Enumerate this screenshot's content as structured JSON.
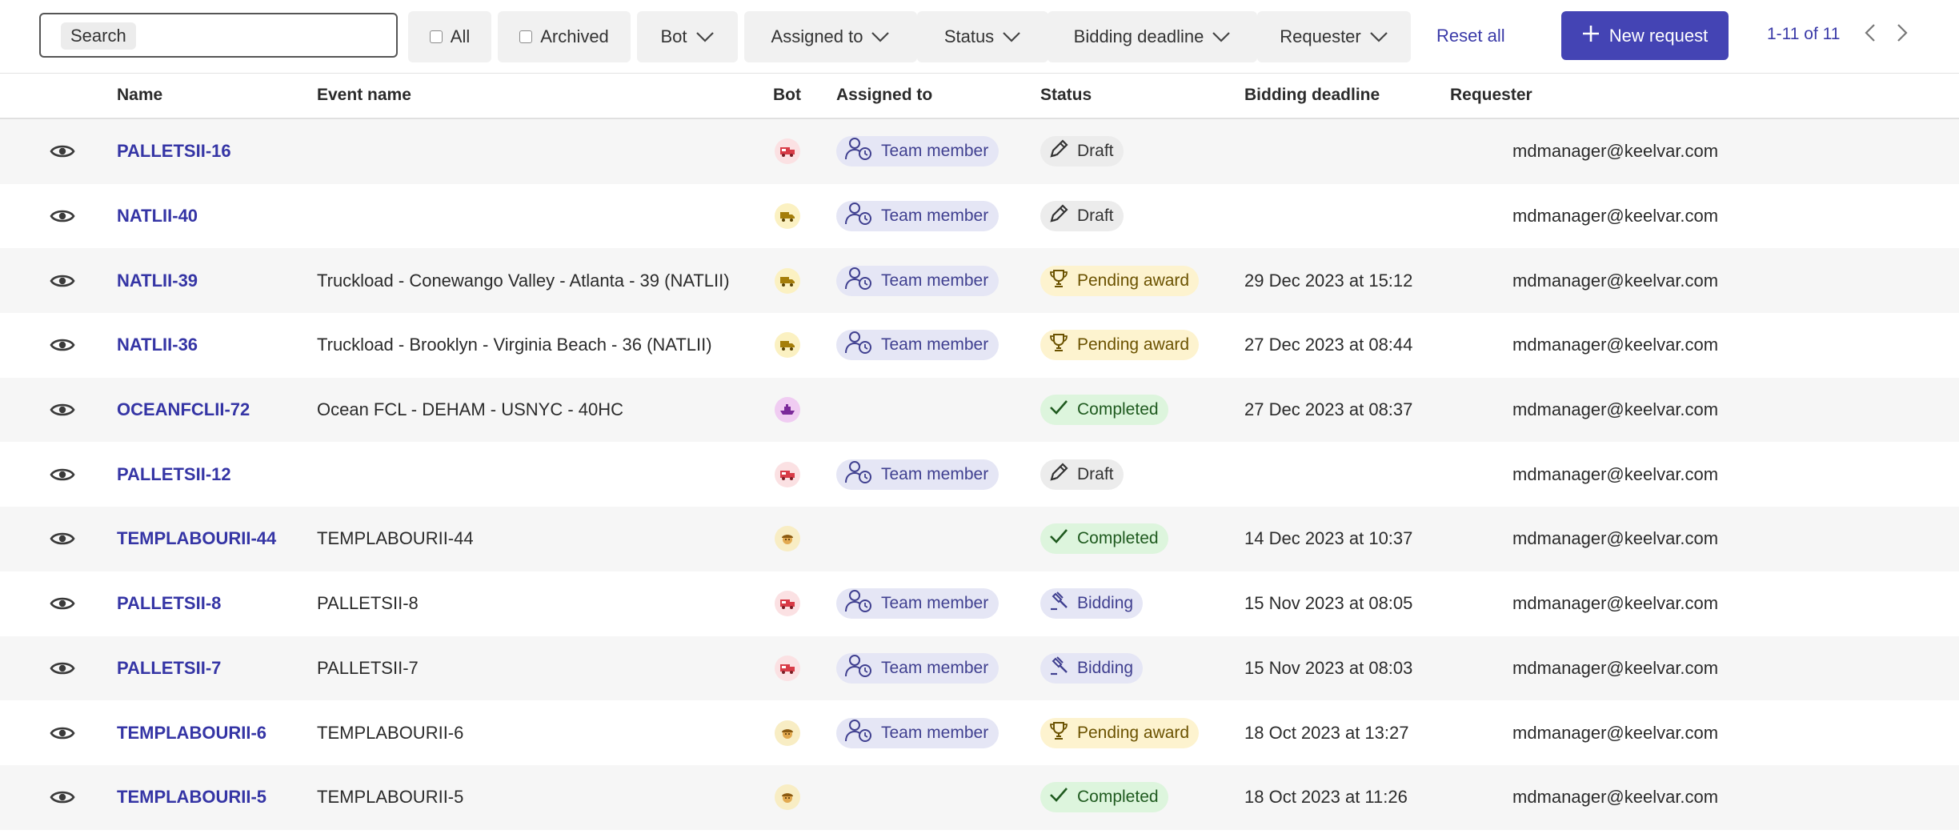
{
  "toolbar": {
    "search_label": "Search",
    "filters": {
      "all": "All",
      "archived": "Archived",
      "bot": "Bot",
      "assigned_to": "Assigned to",
      "status": "Status",
      "bidding_deadline": "Bidding deadline",
      "requester": "Requester"
    },
    "reset_all": "Reset all",
    "new_request": "New request",
    "pagination": "1-11 of 11"
  },
  "columns": {
    "name": "Name",
    "event_name": "Event name",
    "bot": "Bot",
    "assigned_to": "Assigned to",
    "status": "Status",
    "bidding_deadline": "Bidding deadline",
    "requester": "Requester"
  },
  "colors": {
    "accent": "#4444b4",
    "link": "#3535a5",
    "draft": "#ececec",
    "pending": "#fdf3cf",
    "completed": "#ddf5dd",
    "bidding": "#e5e6f5"
  },
  "rows": [
    {
      "name": "PALLETSII-16",
      "event": "",
      "bot": "pallet-bot-icon",
      "assigned": "Team member",
      "status": "Draft",
      "status_type": "draft",
      "deadline": "",
      "requester": "mdmanager@keelvar.com"
    },
    {
      "name": "NATLII-40",
      "event": "",
      "bot": "truck-bot-icon",
      "assigned": "Team member",
      "status": "Draft",
      "status_type": "draft",
      "deadline": "",
      "requester": "mdmanager@keelvar.com"
    },
    {
      "name": "NATLII-39",
      "event": "Truckload - Conewango Valley - Atlanta - 39 (NATLII)",
      "bot": "truck-bot-icon",
      "assigned": "Team member",
      "status": "Pending award",
      "status_type": "pending",
      "deadline": "29 Dec 2023 at 15:12",
      "requester": "mdmanager@keelvar.com"
    },
    {
      "name": "NATLII-36",
      "event": "Truckload - Brooklyn - Virginia Beach - 36 (NATLII)",
      "bot": "truck-bot-icon",
      "assigned": "Team member",
      "status": "Pending award",
      "status_type": "pending",
      "deadline": "27 Dec 2023 at 08:44",
      "requester": "mdmanager@keelvar.com"
    },
    {
      "name": "OCEANFCLII-72",
      "event": "Ocean FCL - DEHAM - USNYC - 40HC",
      "bot": "ship-bot-icon",
      "assigned": "",
      "status": "Completed",
      "status_type": "completed",
      "deadline": "27 Dec 2023 at 08:37",
      "requester": "mdmanager@keelvar.com"
    },
    {
      "name": "PALLETSII-12",
      "event": "",
      "bot": "pallet-bot-icon",
      "assigned": "Team member",
      "status": "Draft",
      "status_type": "draft",
      "deadline": "",
      "requester": "mdmanager@keelvar.com"
    },
    {
      "name": "TEMPLABOURII-44",
      "event": "TEMPLABOURII-44",
      "bot": "worker-bot-icon",
      "assigned": "",
      "status": "Completed",
      "status_type": "completed",
      "deadline": "14 Dec 2023 at 10:37",
      "requester": "mdmanager@keelvar.com"
    },
    {
      "name": "PALLETSII-8",
      "event": "PALLETSII-8",
      "bot": "pallet-bot-icon",
      "assigned": "Team member",
      "status": "Bidding",
      "status_type": "bidding",
      "deadline": "15 Nov 2023 at 08:05",
      "requester": "mdmanager@keelvar.com"
    },
    {
      "name": "PALLETSII-7",
      "event": "PALLETSII-7",
      "bot": "pallet-bot-icon",
      "assigned": "Team member",
      "status": "Bidding",
      "status_type": "bidding",
      "deadline": "15 Nov 2023 at 08:03",
      "requester": "mdmanager@keelvar.com"
    },
    {
      "name": "TEMPLABOURII-6",
      "event": "TEMPLABOURII-6",
      "bot": "worker-bot-icon",
      "assigned": "Team member",
      "status": "Pending award",
      "status_type": "pending",
      "deadline": "18 Oct 2023 at 13:27",
      "requester": "mdmanager@keelvar.com"
    },
    {
      "name": "TEMPLABOURII-5",
      "event": "TEMPLABOURII-5",
      "bot": "worker-bot-icon",
      "assigned": "",
      "status": "Completed",
      "status_type": "completed",
      "deadline": "18 Oct 2023 at 11:26",
      "requester": "mdmanager@keelvar.com"
    }
  ]
}
